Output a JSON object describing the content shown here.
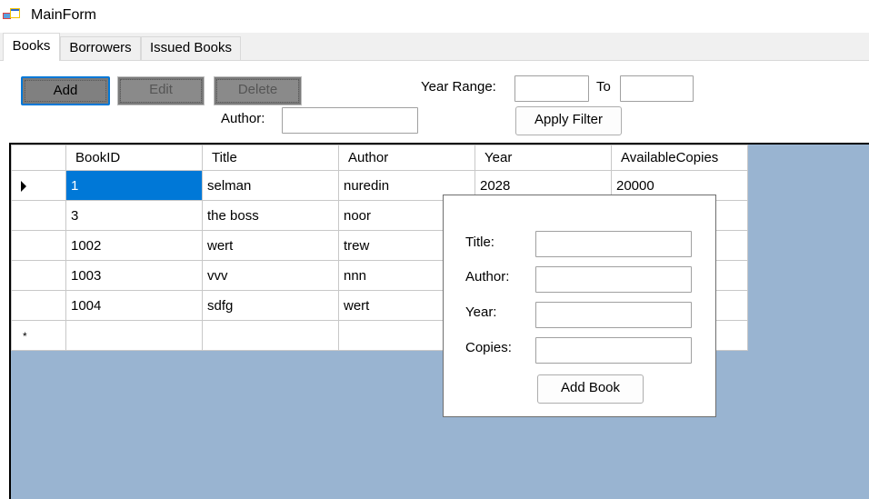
{
  "window": {
    "title": "MainForm"
  },
  "tabs": [
    {
      "label": "Books"
    },
    {
      "label": "Borrowers"
    },
    {
      "label": "Issued Books"
    }
  ],
  "toolbar": {
    "add_label": "Add",
    "edit_label": "Edit",
    "delete_label": "Delete",
    "year_range_label": "Year Range:",
    "to_label": "To",
    "author_label": "Author:",
    "year_from_value": "",
    "year_to_value": "",
    "author_value": "",
    "apply_filter_label": "Apply Filter"
  },
  "grid": {
    "columns": [
      "BookID",
      "Title",
      "Author",
      "Year",
      "AvailableCopies"
    ],
    "rows": [
      {
        "id": "1",
        "title": "selman",
        "author": "nuredin",
        "year": "2028",
        "copies": "20000"
      },
      {
        "id": "3",
        "title": "the boss",
        "author": "noor",
        "year": "",
        "copies": ""
      },
      {
        "id": "1002",
        "title": "wert",
        "author": "trew",
        "year": "",
        "copies": ""
      },
      {
        "id": "1003",
        "title": "vvv",
        "author": "nnn",
        "year": "",
        "copies": ""
      },
      {
        "id": "1004",
        "title": "sdfg",
        "author": "wert",
        "year": "",
        "copies": ""
      }
    ],
    "new_row_marker": "*"
  },
  "add_book_panel": {
    "title_label": "Title:",
    "author_label": "Author:",
    "year_label": "Year:",
    "copies_label": "Copies:",
    "title_value": "",
    "author_value": "",
    "year_value": "",
    "copies_value": "",
    "add_button_label": "Add Book"
  },
  "colors": {
    "grid_background": "#99b4d1",
    "selection": "#0078d7",
    "focus_border": "#0078d7"
  }
}
